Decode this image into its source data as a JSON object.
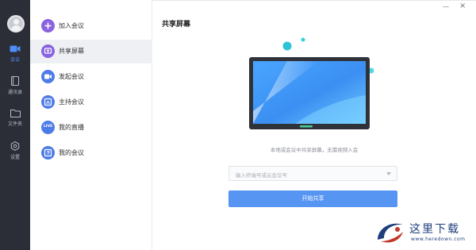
{
  "rail": {
    "items": [
      {
        "key": "meeting",
        "label": "会议",
        "icon": "video-camera-icon"
      },
      {
        "key": "contacts",
        "label": "通讯录",
        "icon": "address-book-icon"
      },
      {
        "key": "files",
        "label": "文件夹",
        "icon": "folder-icon"
      },
      {
        "key": "settings",
        "label": "设置",
        "icon": "settings-icon"
      }
    ]
  },
  "menu": {
    "items": [
      {
        "label": "加入会议",
        "icon": "plus-icon",
        "color": "#8a63e0"
      },
      {
        "label": "共享屏幕",
        "icon": "screen-share-icon",
        "color": "#8a63e0"
      },
      {
        "label": "发起会议",
        "icon": "video-icon",
        "color": "#4d7be8"
      },
      {
        "label": "主持会议",
        "icon": "host-icon",
        "color": "#4d7be8"
      },
      {
        "label": "我的直播",
        "icon": "live-icon",
        "icon_text": "LIVE",
        "color": "#4d7be8"
      },
      {
        "label": "我的会议",
        "icon": "calendar-icon",
        "color": "#4d7be8"
      }
    ]
  },
  "main": {
    "title": "共享屏幕",
    "hint": "本地或会议中共享屏幕，无需视频入会",
    "input": {
      "placeholder": "输入终端号或云会议号"
    },
    "button_label": "开始共享"
  },
  "window": {
    "minimize": "—",
    "close": "×"
  },
  "watermark": {
    "text": "这里下载",
    "url": "www.heredown.com"
  },
  "colors": {
    "accent": "#5795f3",
    "rail_bg": "#2b2e36",
    "menu_active_bg": "#eef0f4"
  }
}
